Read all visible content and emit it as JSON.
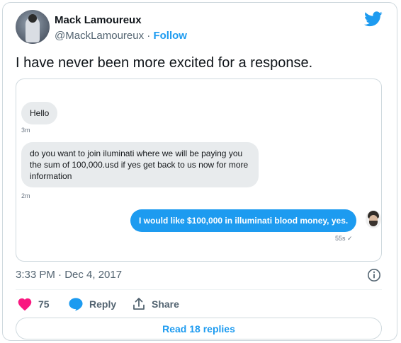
{
  "author": {
    "display_name": "Mack Lamoureux",
    "handle": "@MackLamoureux",
    "separator": " · ",
    "follow_label": "Follow"
  },
  "tweet": {
    "text": "I have never been more excited for a response.",
    "timestamp": "3:33 PM · Dec 4, 2017"
  },
  "dm_screenshot": {
    "messages": [
      {
        "direction": "incoming",
        "text": "Hello",
        "time": "3m"
      },
      {
        "direction": "incoming",
        "text": "do you want to join iluminati where we will be paying you the sum of 100,000.usd if yes get back to us now for more information",
        "time": "2m"
      },
      {
        "direction": "outgoing",
        "text": "I would like $100,000 in illuminati blood money, yes.",
        "time": "55s ✓"
      }
    ]
  },
  "actions": {
    "like_count": "75",
    "reply_label": "Reply",
    "share_label": "Share"
  },
  "read_replies_label": "Read 18 replies",
  "colors": {
    "brand_blue": "#1d9bf0",
    "like_pink": "#f91880",
    "text_secondary": "#536471",
    "border": "#cfd9de"
  },
  "icons": [
    "twitter-bird-icon",
    "info-icon",
    "heart-icon",
    "reply-bubble-icon",
    "share-icon",
    "checkmark-icon"
  ]
}
